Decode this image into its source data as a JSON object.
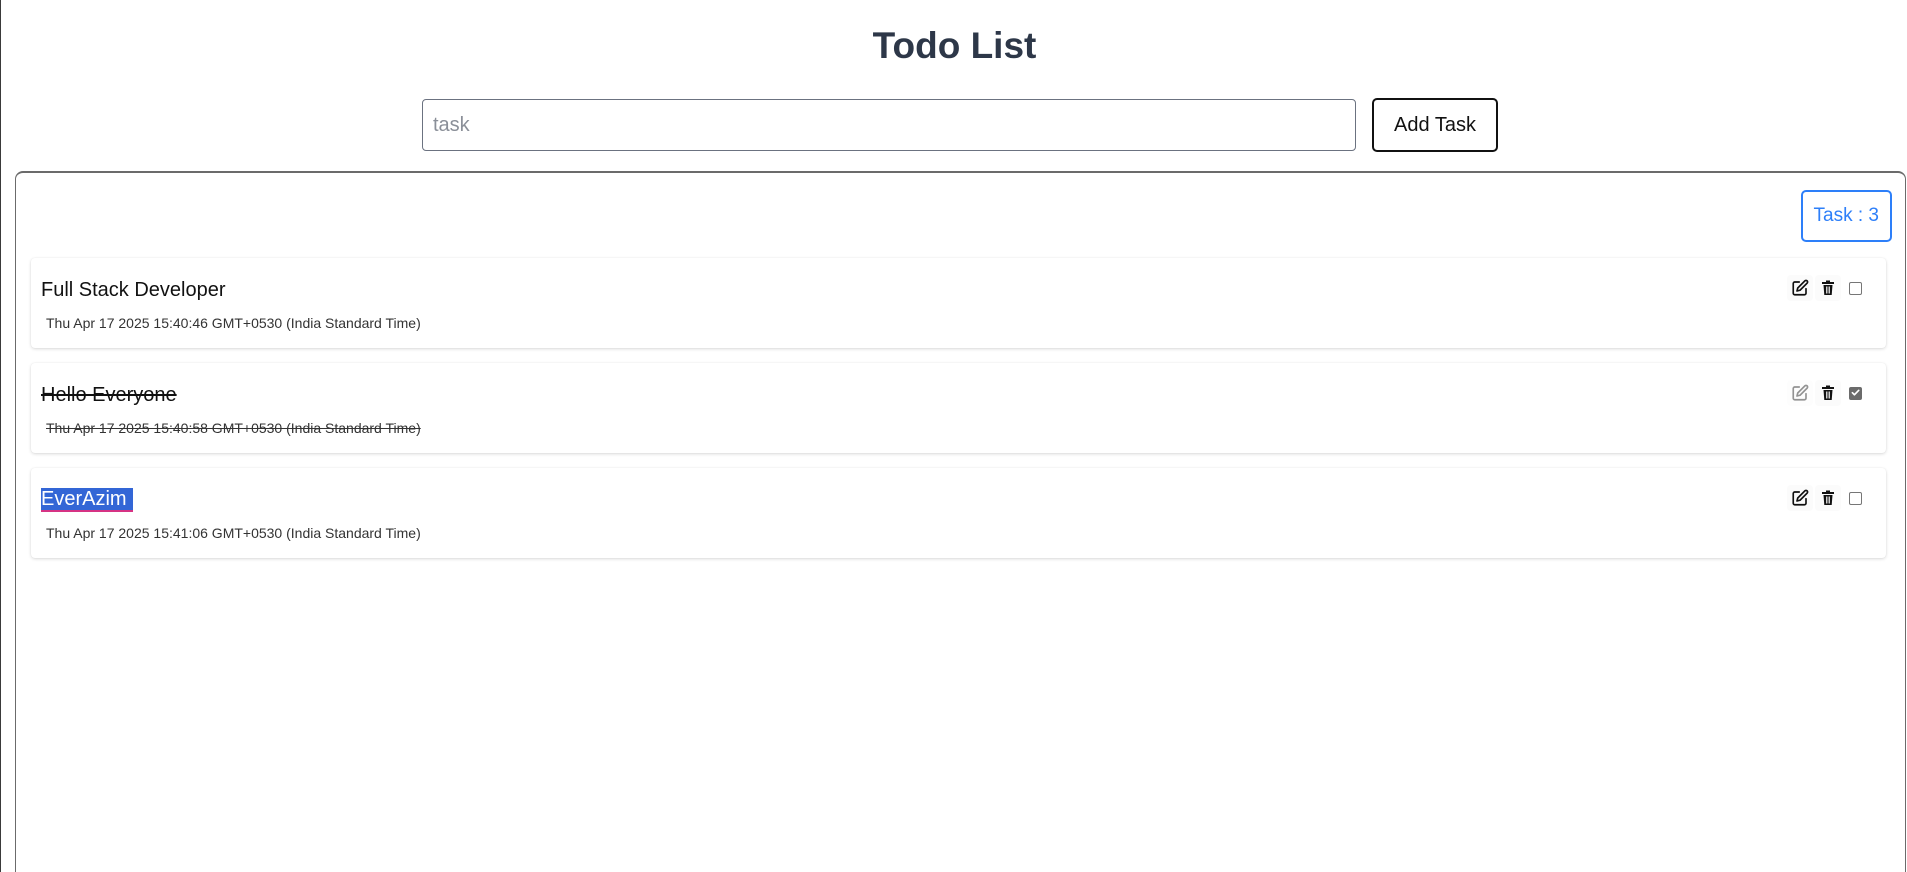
{
  "header": {
    "title": "Todo List"
  },
  "form": {
    "input_placeholder": "task",
    "input_value": "",
    "add_button_label": "Add Task"
  },
  "counter": {
    "label": "Task : 3"
  },
  "tasks": [
    {
      "text": "Full Stack Developer",
      "date": "Thu Apr 17 2025 15:40:46 GMT+0530 (India Standard Time)",
      "completed": false,
      "selected": false
    },
    {
      "text": "Hello Everyone",
      "date": "Thu Apr 17 2025 15:40:58 GMT+0530 (India Standard Time)",
      "completed": true,
      "selected": false
    },
    {
      "text": "EverAzim",
      "date": "Thu Apr 17 2025 15:41:06 GMT+0530 (India Standard Time)",
      "completed": false,
      "selected": true
    }
  ],
  "icons": {
    "edit": "edit-icon",
    "delete": "trash-icon",
    "complete": "checkbox"
  },
  "colors": {
    "title": "#2d3748",
    "accent": "#2d7ff9",
    "selection": "#3366d6"
  }
}
